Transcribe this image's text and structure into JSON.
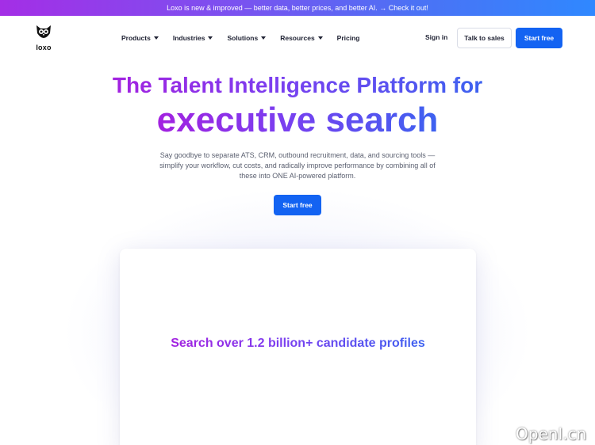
{
  "announcement": {
    "text": "Loxo is new & improved — better data, better prices, and better AI. → Check it out!"
  },
  "brand": {
    "logo_text": "loxo",
    "logo_icon": "owl-logo"
  },
  "nav": {
    "items": [
      {
        "label": "Products",
        "has_dropdown": true
      },
      {
        "label": "Industries",
        "has_dropdown": true
      },
      {
        "label": "Solutions",
        "has_dropdown": true
      },
      {
        "label": "Resources",
        "has_dropdown": true
      },
      {
        "label": "Pricing",
        "has_dropdown": false
      }
    ],
    "signin_label": "Sign in",
    "talk_to_sales_label": "Talk to sales",
    "start_free_label": "Start free"
  },
  "hero": {
    "headline_line1": "The Talent Intelligence Platform for",
    "headline_line2": "executive search",
    "subtitle": "Say goodbye to separate ATS, CRM, outbound recruitment, data, and sourcing tools — simplify your workflow, cut costs, and radically improve performance by combining all of these into ONE AI-powered platform.",
    "cta_label": "Start free"
  },
  "preview_card": {
    "title": "Search over 1.2 billion+ candidate profiles"
  },
  "watermark": {
    "text": "OpenI.cn"
  },
  "colors": {
    "primary_button": "#1363f2",
    "gradient_start": "#a322e0",
    "gradient_end": "#3d62f0"
  }
}
